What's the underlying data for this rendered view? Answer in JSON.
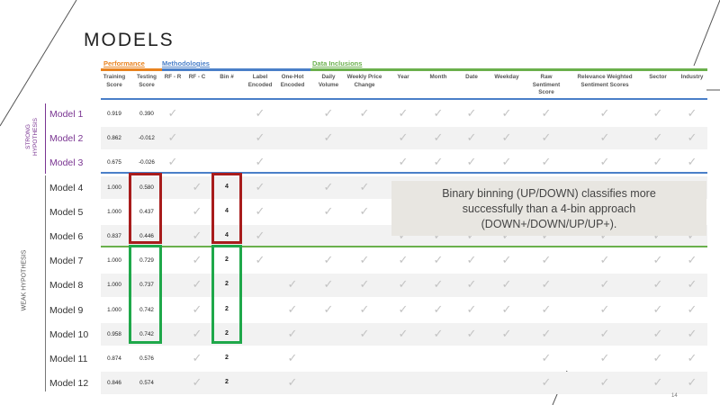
{
  "slide": {
    "title": "MODELS",
    "page_number": "14"
  },
  "groups": [
    {
      "label": "Performance",
      "color": "#e8821e"
    },
    {
      "label": "Methodologies",
      "color": "#4a7fc8"
    },
    {
      "label": "Data Inclusions",
      "color": "#6ab04c"
    }
  ],
  "columns": [
    "Training\nScore",
    "Testing\nScore",
    "RF - R",
    "RF - C",
    "Bin #",
    "Label\nEncoded",
    "One-Hot\nEncoded",
    "Daily\nVolume",
    "Weekly Price\nChange",
    "Year",
    "Month",
    "Date",
    "Weekday",
    "Raw Sentiment\nScore",
    "Relevance Weighted\nSentiment Scores",
    "Sector",
    "Industry"
  ],
  "hypotheses": {
    "strong": {
      "label": "STRONG\nHYPOTHESIS",
      "color": "#7a3592"
    },
    "weak": {
      "label": "WEAK HYPOTHESIS",
      "color": "#555555"
    }
  },
  "rows": [
    {
      "name": "Model 1",
      "train": "0.919",
      "test": "0.390",
      "bin": "",
      "checks": [
        1,
        0,
        0,
        1,
        0,
        1,
        1,
        1,
        1,
        1,
        1,
        1,
        1,
        1,
        1
      ],
      "strong": true
    },
    {
      "name": "Model 2",
      "train": "0.862",
      "test": "-0.012",
      "bin": "",
      "checks": [
        1,
        0,
        0,
        1,
        0,
        1,
        0,
        1,
        1,
        1,
        1,
        1,
        1,
        1,
        1
      ],
      "strong": true
    },
    {
      "name": "Model 3",
      "train": "0.675",
      "test": "-0.026",
      "bin": "",
      "checks": [
        1,
        0,
        0,
        1,
        0,
        0,
        0,
        1,
        1,
        1,
        1,
        1,
        1,
        1,
        1
      ],
      "strong": true
    },
    {
      "name": "Model 4",
      "train": "1.000",
      "test": "0.580",
      "bin": "4",
      "checks": [
        0,
        1,
        0,
        1,
        0,
        1,
        1,
        1,
        1,
        1,
        1,
        1,
        1,
        1,
        1
      ],
      "strong": false
    },
    {
      "name": "Model 5",
      "train": "1.000",
      "test": "0.437",
      "bin": "4",
      "checks": [
        0,
        1,
        0,
        1,
        0,
        1,
        1,
        1,
        1,
        1,
        1,
        1,
        1,
        1,
        1
      ],
      "strong": false
    },
    {
      "name": "Model 6",
      "train": "0.837",
      "test": "0.446",
      "bin": "4",
      "checks": [
        0,
        1,
        0,
        1,
        0,
        0,
        0,
        1,
        1,
        1,
        1,
        1,
        1,
        1,
        1
      ],
      "strong": false
    },
    {
      "name": "Model 7",
      "train": "1.000",
      "test": "0.729",
      "bin": "2",
      "checks": [
        0,
        1,
        0,
        1,
        0,
        1,
        1,
        1,
        1,
        1,
        1,
        1,
        1,
        1,
        1
      ],
      "strong": false
    },
    {
      "name": "Model 8",
      "train": "1.000",
      "test": "0.737",
      "bin": "2",
      "checks": [
        0,
        1,
        0,
        0,
        1,
        1,
        1,
        1,
        1,
        1,
        1,
        1,
        1,
        1,
        1
      ],
      "strong": false
    },
    {
      "name": "Model 9",
      "train": "1.000",
      "test": "0.742",
      "bin": "2",
      "checks": [
        0,
        1,
        0,
        0,
        1,
        1,
        1,
        1,
        1,
        1,
        1,
        1,
        1,
        1,
        1
      ],
      "strong": false
    },
    {
      "name": "Model 10",
      "train": "0.958",
      "test": "0.742",
      "bin": "2",
      "checks": [
        0,
        1,
        0,
        0,
        1,
        0,
        1,
        1,
        1,
        1,
        1,
        1,
        1,
        1,
        1
      ],
      "strong": false
    },
    {
      "name": "Model 11",
      "train": "0.874",
      "test": "0.576",
      "bin": "2",
      "checks": [
        0,
        1,
        0,
        0,
        1,
        0,
        0,
        0,
        0,
        0,
        0,
        1,
        1,
        1,
        1
      ],
      "strong": false
    },
    {
      "name": "Model 12",
      "train": "0.846",
      "test": "0.574",
      "bin": "2",
      "checks": [
        0,
        1,
        0,
        0,
        1,
        0,
        0,
        0,
        0,
        0,
        0,
        1,
        1,
        1,
        1
      ],
      "strong": false
    }
  ],
  "callout": {
    "line1": "Binary binning (UP/DOWN) classifies more",
    "line2": "successfully than a 4-bin approach",
    "line3": "(DOWN+/DOWN/UP/UP+)."
  },
  "colors": {
    "red_box": "#a81c1c",
    "green_box": "#1fa84a",
    "row_shade": "#f2f2f2"
  }
}
